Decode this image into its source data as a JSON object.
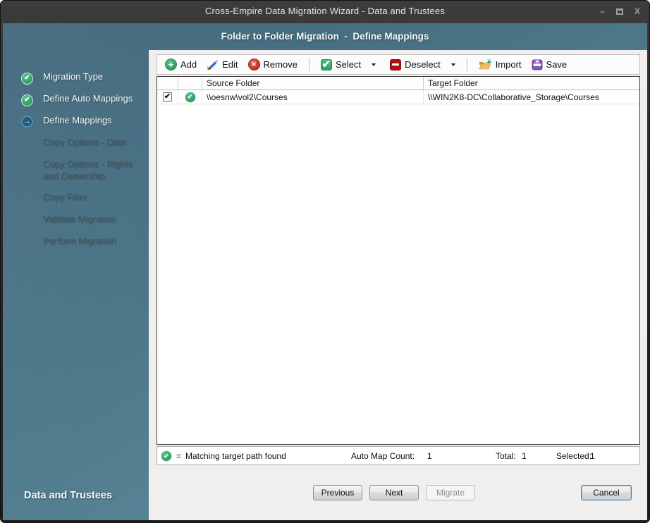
{
  "window": {
    "title": "Cross-Empire Data Migration Wizard - Data and Trustees"
  },
  "header": {
    "title": "Folder to Folder Migration  -  Define Mappings"
  },
  "sidebar": {
    "steps": [
      {
        "label": "Migration Type",
        "status": "done"
      },
      {
        "label": "Define Auto Mappings",
        "status": "done"
      },
      {
        "label": "Define Mappings",
        "status": "current"
      },
      {
        "label": "Copy Options - Data",
        "status": "pending"
      },
      {
        "label": "Copy Options - Rights and Ownership",
        "status": "pending"
      },
      {
        "label": "Copy Filter",
        "status": "pending"
      },
      {
        "label": "Validate Migration",
        "status": "pending"
      },
      {
        "label": "Perform Migration",
        "status": "pending"
      }
    ],
    "footer_label": "Data and Trustees"
  },
  "toolbar": {
    "add_label": "Add",
    "edit_label": "Edit",
    "remove_label": "Remove",
    "select_label": "Select",
    "deselect_label": "Deselect",
    "import_label": "Import",
    "save_label": "Save"
  },
  "table": {
    "columns": {
      "source": "Source Folder",
      "target": "Target Folder"
    },
    "rows": [
      {
        "checked": true,
        "status": "matching-target-found",
        "source": "\\\\oesnw\\vol2\\Courses",
        "target": "\\\\WIN2K8-DC\\Collaborative_Storage\\Courses"
      }
    ]
  },
  "status_bar": {
    "equals": "=",
    "legend_text": "Matching target path found",
    "auto_map_label": "Auto Map Count:",
    "auto_map_value": "1",
    "total_label": "Total:",
    "total_value": "1",
    "selected_label": "Selected:",
    "selected_value": "1"
  },
  "buttons": {
    "previous": "Previous",
    "next": "Next",
    "migrate": "Migrate",
    "cancel": "Cancel"
  },
  "icons": {
    "plus": "+",
    "cross": "✕",
    "check": "✔",
    "arrow_right": "→",
    "minimize": "–",
    "close": "X"
  },
  "colors": {
    "teal_accent": "#4f7d90",
    "green": "#2f9e63",
    "red": "#c42f1f",
    "dark_red": "#b50d0d",
    "purple": "#8a56b0",
    "focus_blue": "#3c7fb1"
  }
}
